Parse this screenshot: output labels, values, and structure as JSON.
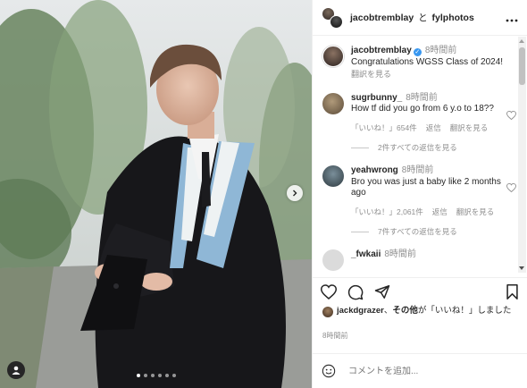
{
  "post": {
    "accounts_title": {
      "owner": "jacobtremblay",
      "conjunction": "と",
      "collaborator": "fylphotos"
    },
    "caption": {
      "username": "jacobtremblay",
      "verified": true,
      "time": "8時間前",
      "text": "Congratulations WGSS Class of 2024!",
      "translate": "翻訳を見る"
    },
    "carousel": {
      "slide_count": 6,
      "active_index": 0
    }
  },
  "comments": [
    {
      "username": "sugrbunny_",
      "time": "8時間前",
      "text": "How tf did you go from 6 y.o to 18??",
      "likes_label": "「いいね！」654件",
      "reply_label": "返信",
      "translate": "翻訳を見る",
      "view_replies": "2件すべての返信を見る"
    },
    {
      "username": "yeahwrong",
      "time": "8時間前",
      "text": "Bro you was just a baby like 2 months ago",
      "likes_label": "「いいね！」2,061件",
      "reply_label": "返信",
      "translate": "翻訳を見る",
      "view_replies": "7件すべての返信を見る"
    },
    {
      "username": "_fwkaii",
      "time": "8時間前"
    }
  ],
  "likes_summary": {
    "user": "jackdgrazer",
    "separator": "、",
    "others": "その他",
    "suffix": "が「いいね！」しました"
  },
  "post_time": "8時間前",
  "comment_input": {
    "placeholder": "コメントを追加..."
  },
  "icons": {
    "like": "heart-icon",
    "comment": "comment-icon",
    "share": "share-icon",
    "save": "bookmark-icon",
    "emoji": "emoji-icon",
    "more": "more-options-icon",
    "next": "chevron-right-icon",
    "tags": "user-tag-icon"
  },
  "colors": {
    "verified": "#3897f0",
    "text": "#262626",
    "muted": "#8e8e8e",
    "gown_stole": "#8fb7d6"
  }
}
